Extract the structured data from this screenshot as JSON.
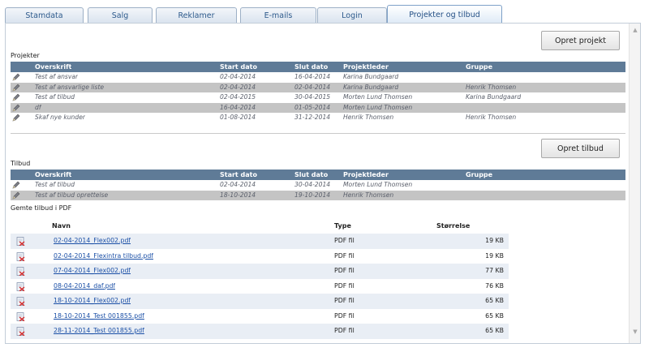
{
  "tabs": [
    {
      "label": "Stamdata"
    },
    {
      "label": "Salg"
    },
    {
      "label": "Reklamer"
    },
    {
      "label": "E-mails"
    },
    {
      "label": "Login"
    },
    {
      "label": "Projekter og tilbud"
    }
  ],
  "projekter": {
    "create_button": "Opret projekt",
    "section_label": "Projekter",
    "headers": {
      "overskrift": "Overskrift",
      "start": "Start dato",
      "slut": "Slut dato",
      "leder": "Projektleder",
      "gruppe": "Gruppe"
    },
    "rows": [
      {
        "overskrift": "Test af ansvar",
        "start": "02-04-2014",
        "slut": "16-04-2014",
        "leder": "Karina Bundgaard",
        "gruppe": ""
      },
      {
        "overskrift": "Test af ansvarlige liste",
        "start": "02-04-2014",
        "slut": "02-04-2014",
        "leder": "Karina Bundgaard",
        "gruppe": "Henrik Thomsen"
      },
      {
        "overskrift": "Test af tilbud",
        "start": "02-04-2015",
        "slut": "30-04-2015",
        "leder": "Morten Lund Thomsen",
        "gruppe": "Karina Bundgaard"
      },
      {
        "overskrift": "df",
        "start": "16-04-2014",
        "slut": "01-05-2014",
        "leder": "Morten Lund Thomsen",
        "gruppe": ""
      },
      {
        "overskrift": "Skaf nye kunder",
        "start": "01-08-2014",
        "slut": "31-12-2014",
        "leder": "Henrik Thomsen",
        "gruppe": "Henrik Thomsen"
      }
    ]
  },
  "tilbud": {
    "create_button": "Opret tilbud",
    "section_label": "Tilbud",
    "headers": {
      "overskrift": "Overskrift",
      "start": "Start dato",
      "slut": "Slut dato",
      "leder": "Projektleder",
      "gruppe": "Gruppe"
    },
    "rows": [
      {
        "overskrift": "Test af tilbud",
        "start": "02-04-2014",
        "slut": "30-04-2014",
        "leder": "Morten Lund Thomsen",
        "gruppe": ""
      },
      {
        "overskrift": "Test af tilbud oprettelse",
        "start": "18-10-2014",
        "slut": "19-10-2014",
        "leder": "Henrik Thomsen",
        "gruppe": ""
      }
    ]
  },
  "pdf": {
    "section_label": "Gemte tilbud i PDF",
    "headers": {
      "navn": "Navn",
      "type": "Type",
      "size": "Størrelse"
    },
    "rows": [
      {
        "navn": "02-04-2014_Flex002.pdf",
        "type": "PDF fil",
        "size": "19 KB"
      },
      {
        "navn": "02-04-2014_Flexintra tilbud.pdf",
        "type": "PDF fil",
        "size": "19 KB"
      },
      {
        "navn": "07-04-2014_Flex002.pdf",
        "type": "PDF fil",
        "size": "77 KB"
      },
      {
        "navn": "08-04-2014_daf.pdf",
        "type": "PDF fil",
        "size": "76 KB"
      },
      {
        "navn": "18-10-2014_Flex002.pdf",
        "type": "PDF fil",
        "size": "65 KB"
      },
      {
        "navn": "18-10-2014_Test 001855.pdf",
        "type": "PDF fil",
        "size": "65 KB"
      },
      {
        "navn": "28-11-2014_Test 001855.pdf",
        "type": "PDF fil",
        "size": "65 KB"
      }
    ]
  },
  "icons": {
    "edit": "pencil-icon",
    "pdf": "pdf-file-icon",
    "scroll_up": "scroll-up-arrow-icon",
    "scroll_down": "scroll-down-arrow-icon"
  }
}
